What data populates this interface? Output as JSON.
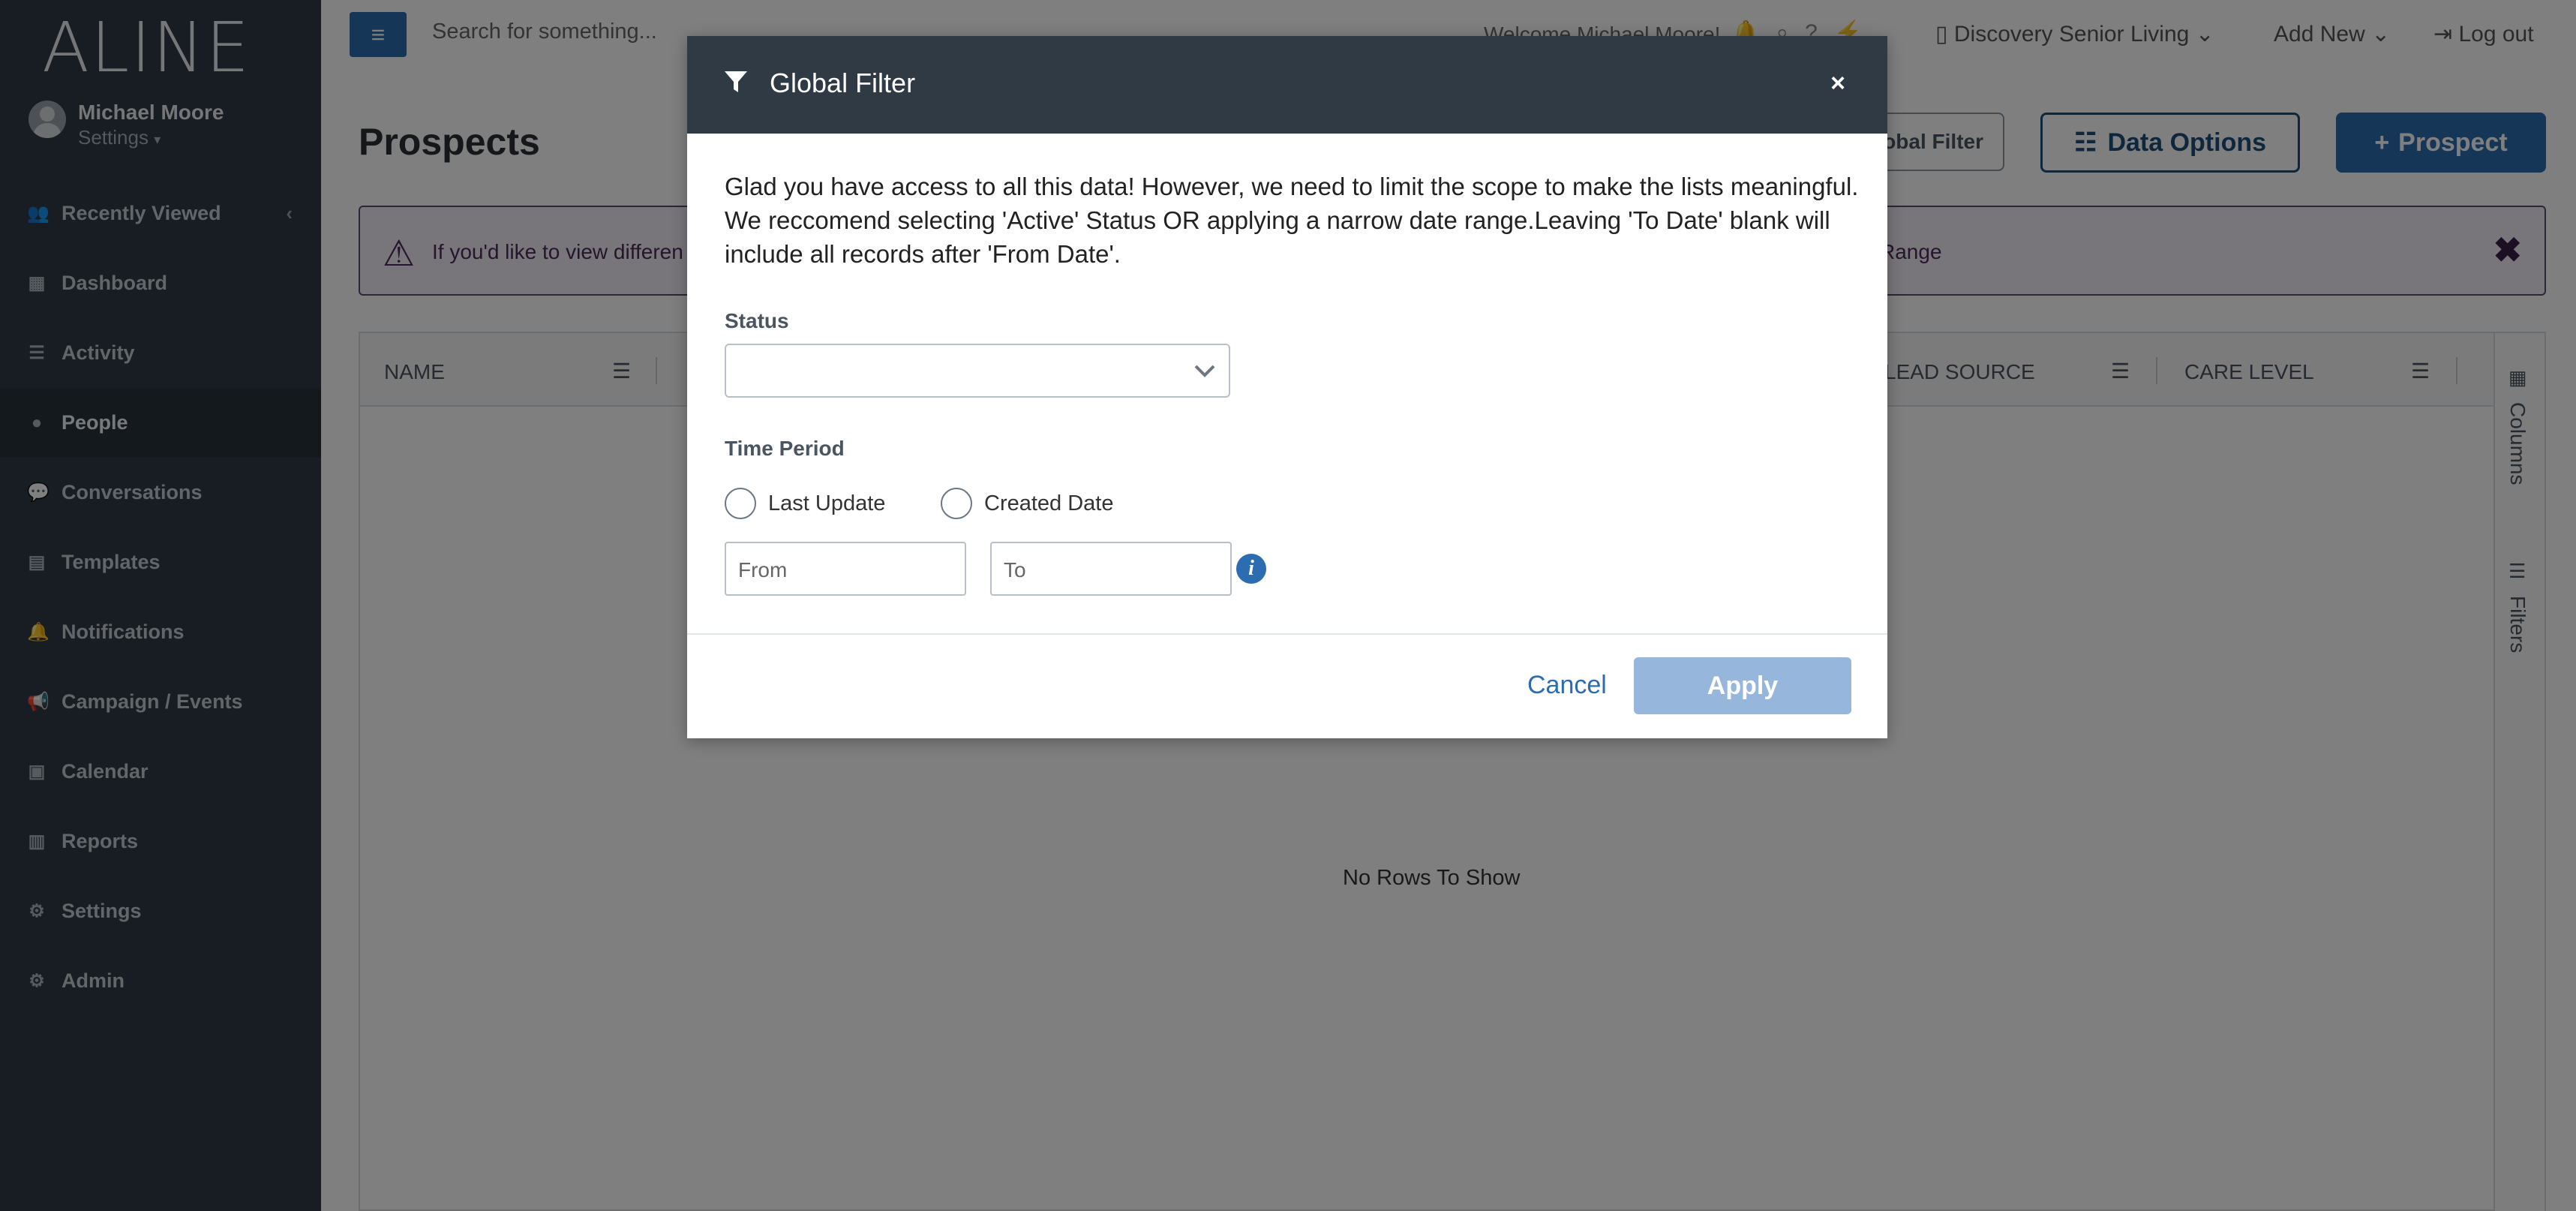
{
  "app": {
    "logo": "ALINE"
  },
  "user": {
    "name": "Michael Moore",
    "settings_label": "Settings"
  },
  "nav": {
    "items": [
      {
        "label": "Recently Viewed",
        "icon": "users-icon"
      },
      {
        "label": "Dashboard",
        "icon": "dashboard-icon"
      },
      {
        "label": "Activity",
        "icon": "activity-icon"
      },
      {
        "label": "People",
        "icon": "person-icon"
      },
      {
        "label": "Conversations",
        "icon": "chat-icon"
      },
      {
        "label": "Templates",
        "icon": "file-icon"
      },
      {
        "label": "Notifications",
        "icon": "bell-icon"
      },
      {
        "label": "Campaign / Events",
        "icon": "megaphone-icon"
      },
      {
        "label": "Calendar",
        "icon": "calendar-icon"
      },
      {
        "label": "Reports",
        "icon": "bar-chart-icon"
      },
      {
        "label": "Settings",
        "icon": "gear-icon"
      },
      {
        "label": "Admin",
        "icon": "admin-gears-icon"
      }
    ],
    "active": "People"
  },
  "topbar": {
    "search_placeholder": "Search for something...",
    "welcome": "Welcome Michael Moore!",
    "community": "Discovery Senior Living",
    "add_new": "Add New",
    "logout": "Log out"
  },
  "page": {
    "title": "Prospects",
    "global_filter_btn": "Global Filter",
    "data_options_btn": "Data Options",
    "prospect_btn": "Prospect"
  },
  "alert": {
    "text_start": "If you'd like to view differen",
    "text_end": "Range"
  },
  "grid": {
    "columns": [
      "NAME",
      "LEAD SOURCE",
      "CARE LEVEL"
    ],
    "empty_text": "No Rows To Show",
    "side_tabs": [
      "Columns",
      "Filters"
    ]
  },
  "modal": {
    "title": "Global Filter",
    "close": "×",
    "description": "Glad you have access to all this data! However, we need to limit the scope to make the lists meaningful. We reccomend selecting 'Active' Status OR applying a narrow date range.Leaving 'To Date' blank will include all records after 'From Date'.",
    "status_label": "Status",
    "status_value": "",
    "time_period_label": "Time Period",
    "radio_last_update": "Last Update",
    "radio_created_date": "Created Date",
    "from_placeholder": "From",
    "to_placeholder": "To",
    "cancel": "Cancel",
    "apply": "Apply"
  },
  "colors": {
    "sidebar": "#2f3a44",
    "primary": "#2c6cb0",
    "apply_disabled": "#97b6db",
    "alert_bg": "#f3ecf6"
  }
}
